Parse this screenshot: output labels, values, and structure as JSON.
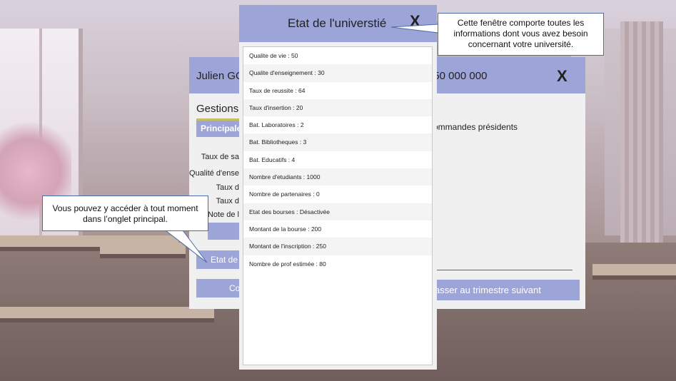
{
  "main_window": {
    "user_name": "Julien GO",
    "budget": ": 50 000 000",
    "close_glyph": "X",
    "gestions_title": "Gestions e",
    "tab_principales": "Principales",
    "stat_labels": [
      "Taux de sa",
      "Qualité d'ense",
      "Taux d",
      "Taux d",
      "Note de l"
    ],
    "etat_button": "Etat de l'",
    "co_button": "Co",
    "commandes_text": "ommandes présidents",
    "next_button": "asser au trimestre suivant"
  },
  "dialog": {
    "title": "Etat de l'universtié",
    "close_glyph": "X",
    "stats": [
      "Qualite de vie : 50",
      "Qualite d'enseignement : 30",
      "Taux de reussite : 64",
      "Taux d'insertion : 20",
      "Bat. Laboratoires : 2",
      "Bat. Bibliotheques : 3",
      "Bat. Educatifs : 4",
      "Nombre d'etudiants : 1000",
      "Nombre de partenaires : 0",
      "Etat des bourses : Désactivée",
      "Montant de la bourse : 200",
      "Montant de l'inscription : 250",
      "Nombre de prof estimée : 80"
    ]
  },
  "callouts": {
    "top": [
      "Cette fenêtre comporte toutes les",
      "informations dont vous avez besoin",
      "concernant votre université."
    ],
    "left": [
      "Vous pouvez y accéder à tout moment",
      "dans l’onglet principal."
    ]
  },
  "colors": {
    "accent": "#9da5d8",
    "callout_border": "#4a6ea0"
  }
}
